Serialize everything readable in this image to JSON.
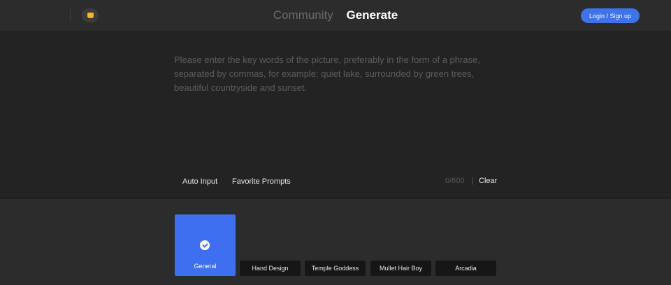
{
  "header": {
    "logo_icon": "lock-icon",
    "tabs": [
      {
        "label": "Community",
        "active": false
      },
      {
        "label": "Generate",
        "active": true
      }
    ],
    "login_label": "Login / Sign up",
    "accent_color": "#3e74e8"
  },
  "editor": {
    "placeholder": "Please enter the key words of the picture, preferably in the form of a phrase, separated by commas, for example: quiet lake, surrounded by green trees, beautiful countryside and sunset.",
    "value": "",
    "auto_input_label": "Auto Input",
    "favorite_prompts_label": "Favorite Prompts",
    "counter": "0/600",
    "separator": "|",
    "clear_label": "Clear"
  },
  "styles": {
    "selected_icon": "check-circle-icon",
    "items": [
      {
        "label": "General",
        "selected": true
      },
      {
        "label": "Hand Design",
        "selected": false
      },
      {
        "label": "Temple Goddess",
        "selected": false
      },
      {
        "label": "Mullet Hair Boy",
        "selected": false
      },
      {
        "label": "Arcadia",
        "selected": false
      }
    ]
  }
}
